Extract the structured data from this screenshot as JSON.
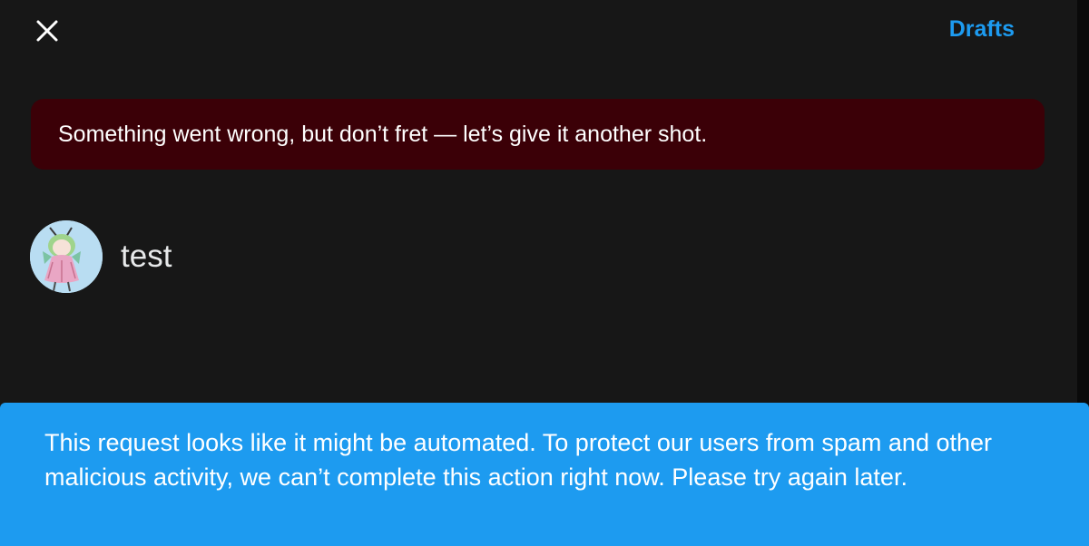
{
  "header": {
    "close_icon": "close-icon",
    "drafts_label": "Drafts"
  },
  "error_banner": {
    "message": "Something went wrong, but don’t fret — let’s give it another shot."
  },
  "composer": {
    "avatar": "avatar",
    "text": "test"
  },
  "toast": {
    "message": "This request looks like it might be automated. To protect our users from spam and other malicious activity, we can’t complete this action right now. Please try again later."
  },
  "colors": {
    "accent": "#1d9bf0",
    "error_background": "#3b0007",
    "surface": "#171717"
  }
}
